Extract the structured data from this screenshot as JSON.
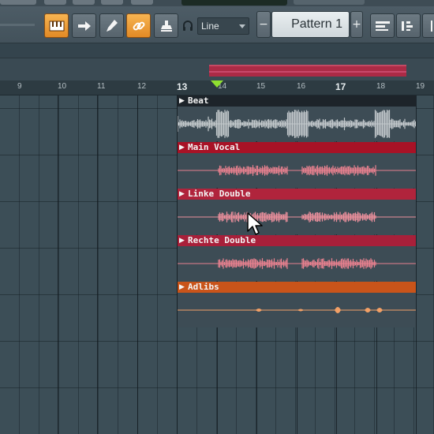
{
  "toolbar": {
    "snap_label": "Line",
    "pattern_label": "Pattern 1",
    "minus_label": "−",
    "plus_label": "+"
  },
  "ruler": {
    "ticks": [
      "9",
      "10",
      "11",
      "12",
      "13",
      "14",
      "15",
      "16",
      "17",
      "18",
      "19"
    ]
  },
  "tracks": [
    {
      "name": "Beat",
      "header_color": "#1d242a",
      "body_color": "#3d4c55",
      "wave_color": "#c3c9cc"
    },
    {
      "name": "Main Vocal",
      "header_color": "#a81226",
      "body_color": "#3d4c55",
      "wave_color": "#e8818f"
    },
    {
      "name": "Linke Double",
      "header_color": "#b0243c",
      "body_color": "#3d4c55",
      "wave_color": "#eb8f9c"
    },
    {
      "name": "Rechte Double",
      "header_color": "#a8203a",
      "body_color": "#3d4c55",
      "wave_color": "#e8818f"
    },
    {
      "name": "Adlibs",
      "header_color": "#c9541a",
      "body_color": "#3d4c55",
      "wave_color": "#f2a066"
    }
  ],
  "colors": {
    "accent_orange": "#e6932c",
    "playhead_marker": "#8fe030"
  }
}
